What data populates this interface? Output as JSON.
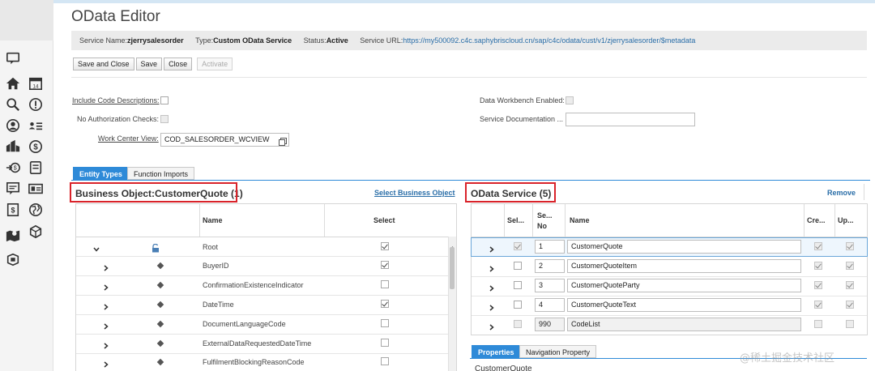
{
  "editor": {
    "title": "OData Editor"
  },
  "service_bar": {
    "name_label": "Service Name:",
    "name_value": "zjerrysalesorder",
    "type_label": "Type:",
    "type_value": "Custom OData Service",
    "status_label": "Status:",
    "status_value": "Active",
    "url_label": "Service URL:",
    "url_value": "https://my500092.c4c.saphybriscloud.cn/sap/c4c/odata/cust/v1/zjerrysalesorder/$metadata"
  },
  "toolbar": {
    "save_close": "Save and Close",
    "save": "Save",
    "close": "Close",
    "activate": "Activate"
  },
  "options": {
    "include_code_desc": "Include Code Descriptions:",
    "no_auth_checks": "No Authorization Checks:",
    "work_center_view": "Work Center View:",
    "work_center_value": "COD_SALESORDER_WCVIEW",
    "data_workbench": "Data Workbench Enabled:",
    "service_doc": "Service Documentation ..."
  },
  "tabs": {
    "entity_types": "Entity Types",
    "function_imports": "Function Imports"
  },
  "bo_panel": {
    "title": "Business Object:CustomerQuote (1)",
    "select_link": "Select Business Object",
    "columns": {
      "name": "Name",
      "select": "Select"
    },
    "rows": [
      {
        "name": "Root",
        "checked": true
      },
      {
        "name": "BuyerID",
        "checked": true
      },
      {
        "name": "ConfirmationExistenceIndicator",
        "checked": false
      },
      {
        "name": "DateTime",
        "checked": true
      },
      {
        "name": "DocumentLanguageCode",
        "checked": false
      },
      {
        "name": "ExternalDataRequestedDateTime",
        "checked": false
      },
      {
        "name": "FulfilmentBlockingReasonCode",
        "checked": false
      }
    ]
  },
  "odata_panel": {
    "title": "OData Service (5)",
    "remove_link": "Remove",
    "columns": {
      "sel": "Sel...",
      "seq": "Se...",
      "seq2": "No",
      "name": "Name",
      "cre": "Cre...",
      "upd": "Up..."
    },
    "rows": [
      {
        "seq": "1",
        "name": "CustomerQuote"
      },
      {
        "seq": "2",
        "name": "CustomerQuoteItem"
      },
      {
        "seq": "3",
        "name": "CustomerQuoteParty"
      },
      {
        "seq": "4",
        "name": "CustomerQuoteText"
      },
      {
        "seq": "990",
        "name": "CodeList"
      }
    ]
  },
  "bottom_tabs": {
    "properties": "Properties",
    "navigation": "Navigation Property"
  },
  "bottom_text": "CustomerQuote",
  "watermark": "@稀土掘金技术社区",
  "colors": {
    "accent": "#2e8ad8",
    "highlight_border": "#d9232a",
    "link": "#2a6ea8"
  }
}
